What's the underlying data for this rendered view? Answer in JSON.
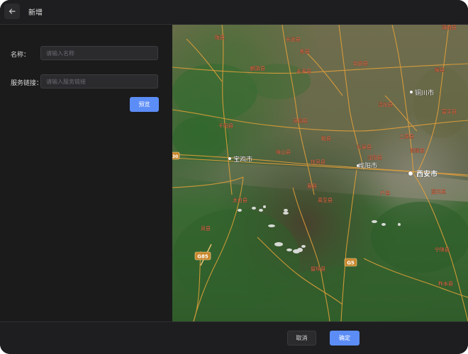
{
  "header": {
    "back_icon": "arrow-left-icon",
    "title": "新增"
  },
  "form": {
    "name_label": "名称：",
    "name_placeholder": "请输入名称",
    "url_label": "服务链接：",
    "url_placeholder": "请输入服务链接",
    "preview_label": "预览"
  },
  "map": {
    "labels": {
      "yulin": "铜川市",
      "baoji": "宝鸡市",
      "xianyang": "咸阳市",
      "xian": "西安市",
      "zhouzhi": "周至县",
      "qishan": "岐山县",
      "fufeng": "扶风县",
      "meixian": "眉县",
      "liquan": "礼泉县",
      "qianxian": "乾县",
      "fengxiang": "凤翔县",
      "linyou": "麟游县",
      "yongshou": "永寿县",
      "chunhua": "淳化县",
      "sanyuan": "三原县",
      "lantian": "蓝田县",
      "huxian": "户县",
      "taibai": "太白县",
      "fengxian": "凤县",
      "liuba": "留坝县",
      "ningshan": "宁陕县",
      "zhashui": "柞水县",
      "xunyi": "旬邑县",
      "binxian": "彬县",
      "changwu": "长武县",
      "longxian": "陇县",
      "qianyang": "千阳县",
      "jingyang": "泾阳县",
      "gaoling": "高陵县",
      "yaoxian": "耀县",
      "fuping": "富平县",
      "pucheng": "蒲城县"
    },
    "highways": {
      "g85": "G85",
      "g5": "G5",
      "g30": "30"
    }
  },
  "footer": {
    "cancel_label": "取消",
    "confirm_label": "确定"
  }
}
